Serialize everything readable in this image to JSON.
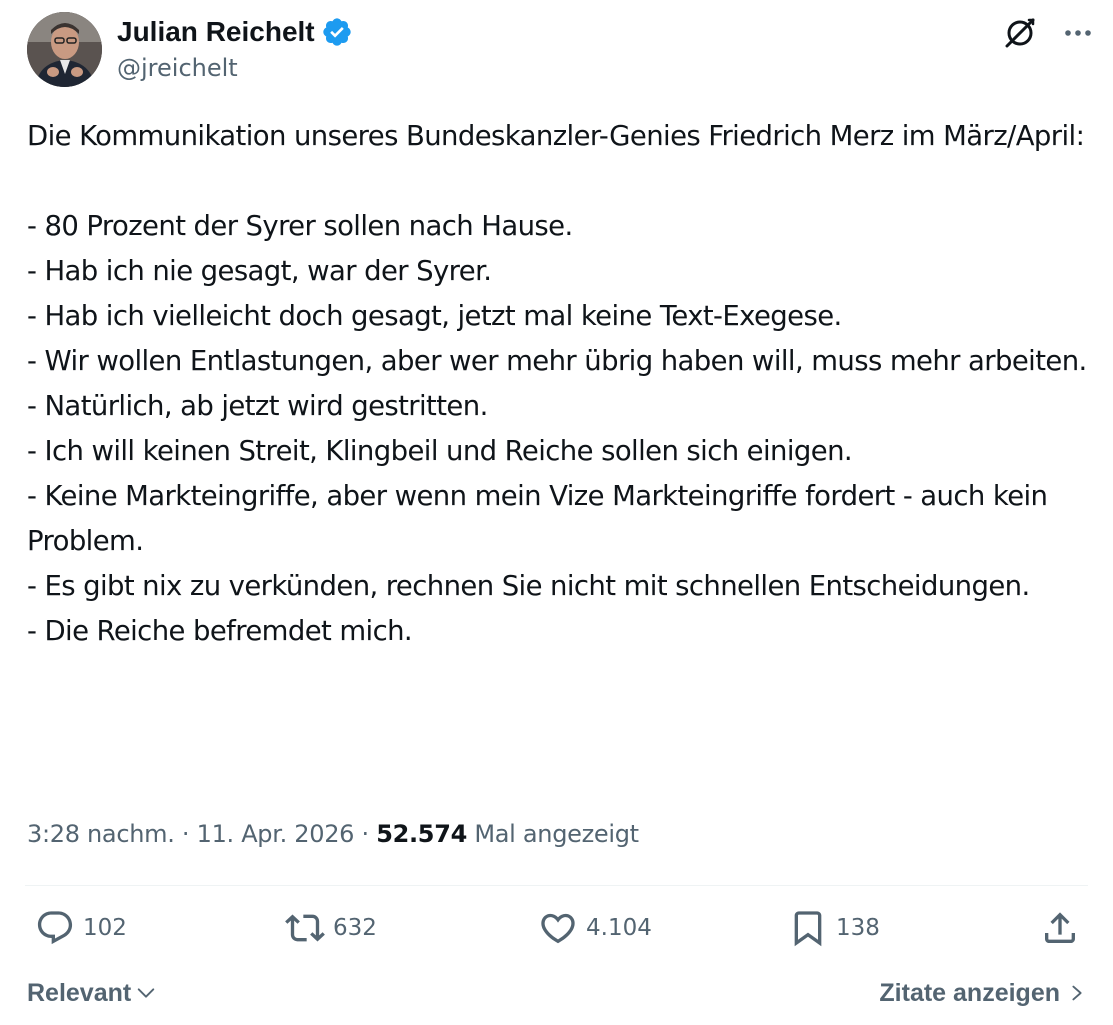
{
  "author": {
    "name": "Julian Reichelt",
    "handle": "@jreichelt",
    "verified": true
  },
  "tweet": {
    "text": "Die Kommunikation unseres Bundeskanzler-Genies Friedrich Merz im März/April:\n\n- 80 Prozent der Syrer sollen nach Hause.\n- Hab ich nie gesagt, war der Syrer.\n- Hab ich vielleicht doch gesagt, jetzt mal keine Text-Exegese.\n- Wir wollen Entlastungen, aber wer mehr übrig haben will, muss mehr arbeiten.\n- Natürlich, ab jetzt wird gestritten.\n- Ich will keinen Streit, Klingbeil und Reiche sollen sich einigen.\n- Keine Markteingriffe, aber wenn mein Vize Markteingriffe fordert - auch kein Problem.\n- Es gibt nix zu verkünden, rechnen Sie nicht mit schnellen Entscheidungen.\n- Die Reiche befremdet mich."
  },
  "meta": {
    "time": "3:28 nachm.",
    "separator": "·",
    "date": "11. Apr. 2026",
    "views_count": "52.574",
    "views_label": "Mal angezeigt"
  },
  "actions": {
    "replies": "102",
    "retweets": "632",
    "likes": "4.104",
    "bookmarks": "138"
  },
  "footer": {
    "sort_label": "Relevant",
    "quotes_label": "Zitate anzeigen"
  },
  "icons": {
    "verified": "verified-badge-icon",
    "grok": "grok-icon",
    "more": "more-dots-icon",
    "reply": "reply-icon",
    "retweet": "retweet-icon",
    "like": "heart-icon",
    "bookmark": "bookmark-icon",
    "share": "share-icon"
  },
  "colors": {
    "text": "#0f1419",
    "secondary": "#536471",
    "verified": "#1d9bf0",
    "divider": "#eff3f4"
  }
}
